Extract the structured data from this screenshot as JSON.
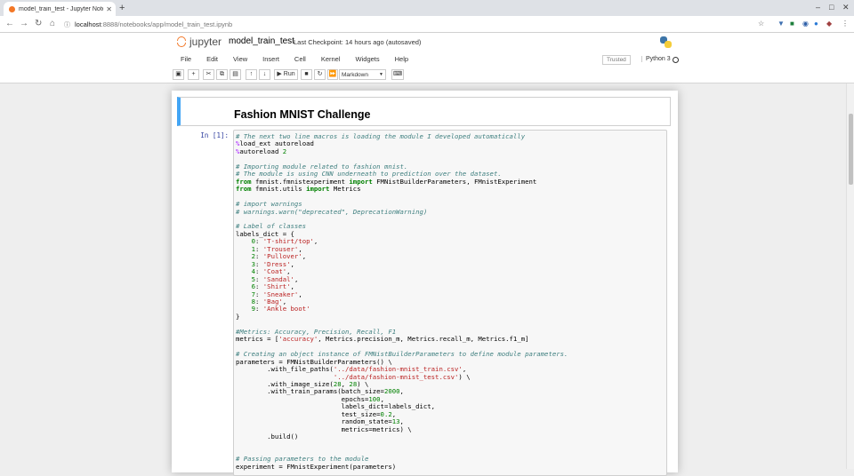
{
  "browser": {
    "tab_title": "model_train_test - Jupyter Note",
    "new_tab_symbol": "+",
    "url_host": "localhost",
    "url_path": ":8888/notebooks/app/model_train_test.ipynb"
  },
  "jupyter": {
    "logo_text": "jupyter",
    "notebook_name": "model_train_test",
    "checkpoint_text": "Last Checkpoint: 14 hours ago  (autosaved)",
    "menu": [
      "File",
      "Edit",
      "View",
      "Insert",
      "Cell",
      "Kernel",
      "Widgets",
      "Help"
    ],
    "trusted_label": "Trusted",
    "kernel_name": "Python 3",
    "toolbar": {
      "run_label": "Run",
      "cell_type": "Markdown"
    }
  },
  "notebook": {
    "markdown_heading": "Fashion MNIST Challenge",
    "cell_prompt": "In [1]:"
  },
  "colors": {
    "jupyter_orange": "#f37726",
    "prompt_blue": "#303f9f",
    "markdown_selected_bar": "#42a5f5"
  }
}
